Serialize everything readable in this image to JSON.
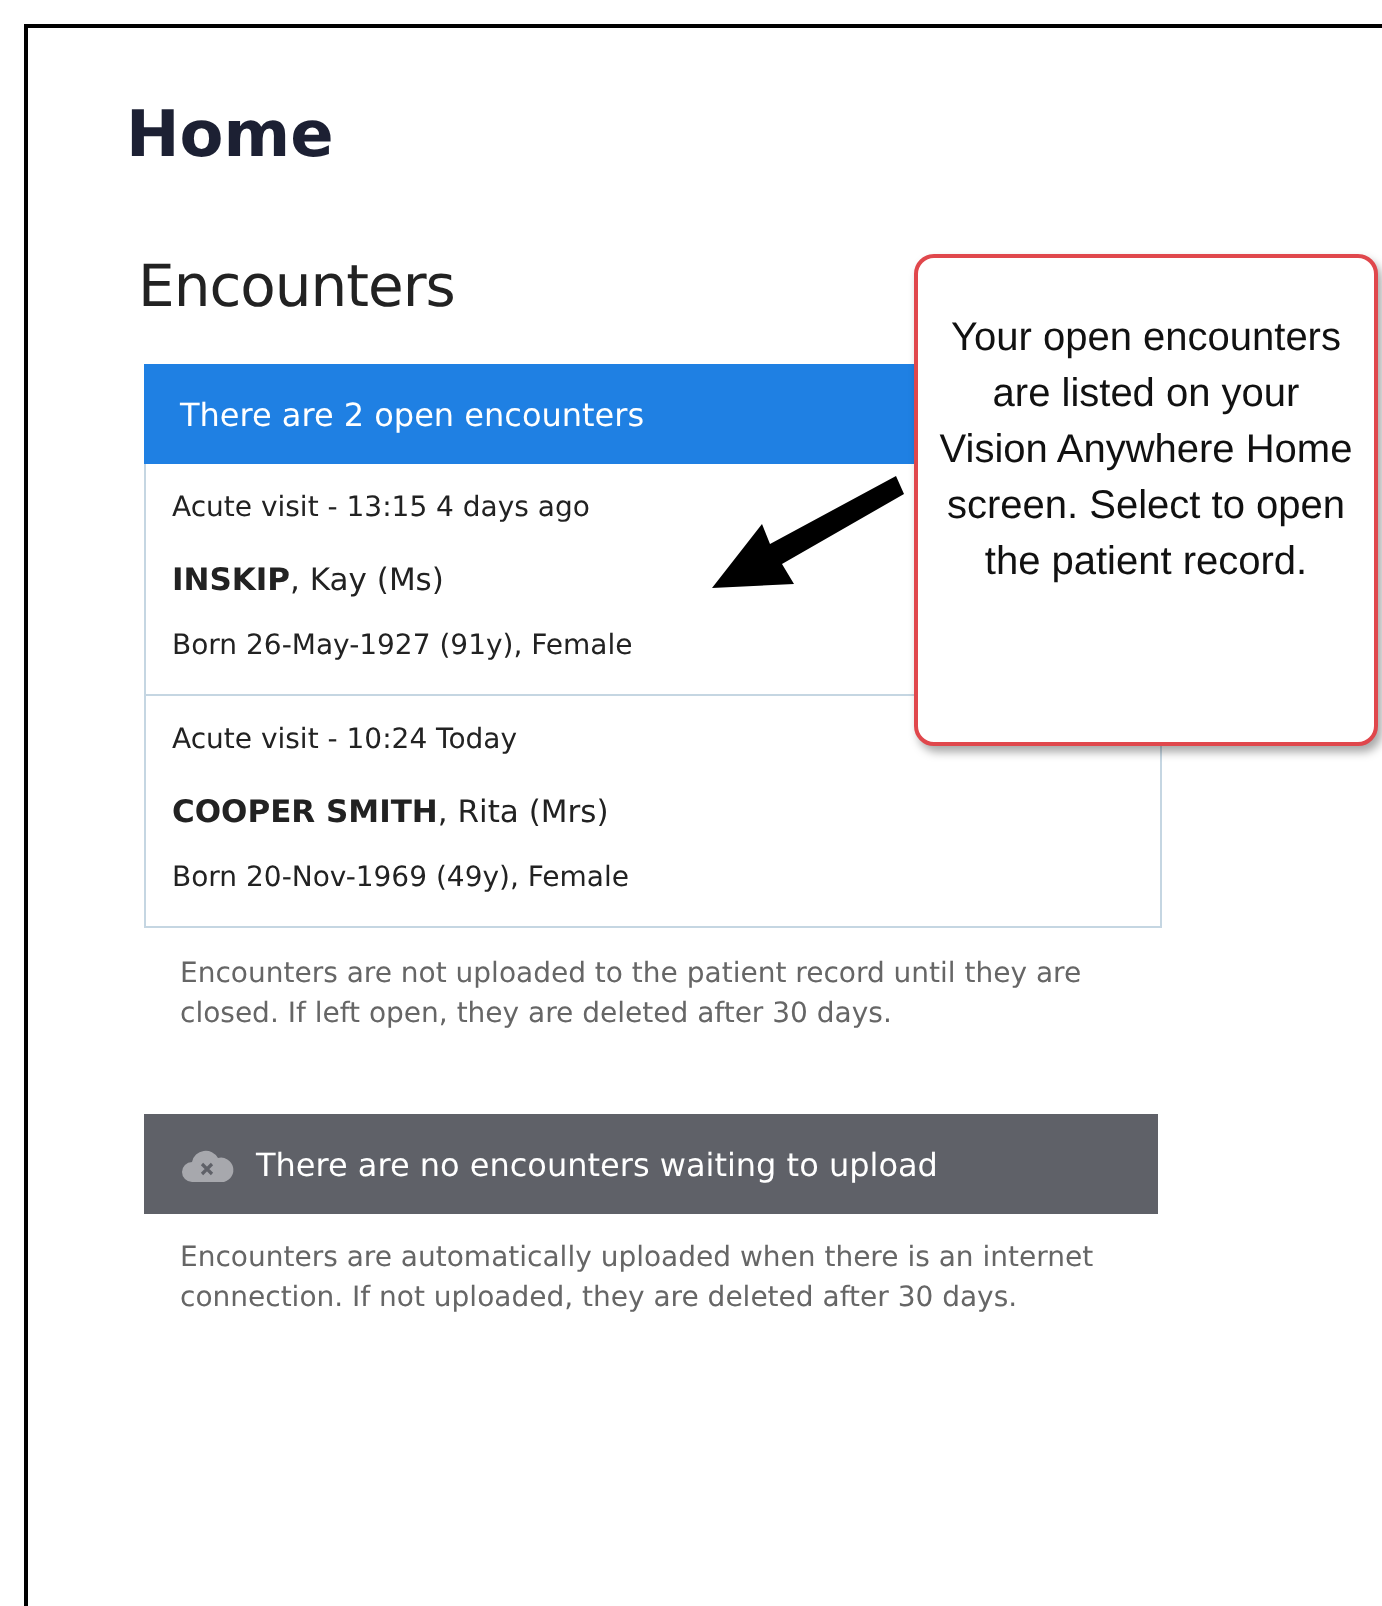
{
  "page": {
    "title": "Home"
  },
  "encounters": {
    "heading": "Encounters",
    "banner": "There are 2 open encounters",
    "items": [
      {
        "visit": "Acute visit - 13:15  4 days ago",
        "patient": "**INSKIP**, Kay (Ms)",
        "details": "Born 26-May-1927 (91y), Female"
      },
      {
        "visit": "Acute visit - 10:24  Today",
        "patient": "**COOPER SMITH**, Rita (Mrs)",
        "details": "Born 20-Nov-1969 (49y), Female"
      }
    ],
    "note": "Encounters are not uploaded to the patient record until they are closed. If left open, they are deleted after 30 days."
  },
  "upload": {
    "banner": "There are no encounters waiting to upload",
    "note": "Encounters are automatically uploaded when there is an internet connection. If not uploaded, they are deleted after 30 days."
  },
  "callout": {
    "text": "Your open encounters are listed on your Vision Anywhere Home screen. Select to open the patient record."
  }
}
